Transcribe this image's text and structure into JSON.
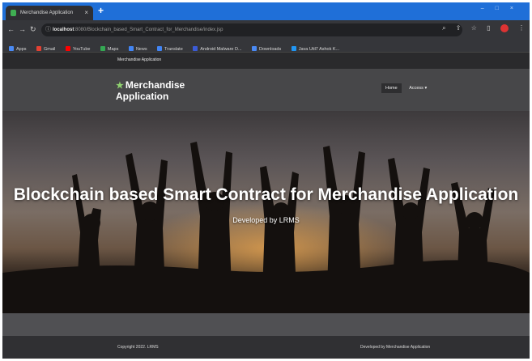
{
  "browser": {
    "tab_title": "Merchandise Application",
    "tab_close": "×",
    "new_tab": "+",
    "url_host": "localhost",
    "url_path": ":8080/Blockchain_based_Smart_Contract_for_Merchandise/index.jsp",
    "bookmarks": [
      {
        "label": "Apps",
        "color": "#4a8af4"
      },
      {
        "label": "Gmail",
        "color": "#e34133"
      },
      {
        "label": "YouTube",
        "color": "#ff0000"
      },
      {
        "label": "Maps",
        "color": "#34a853"
      },
      {
        "label": "News",
        "color": "#4285f4"
      },
      {
        "label": "Translate",
        "color": "#4285f4"
      },
      {
        "label": "Android Malware D...",
        "color": "#3b5bd6"
      },
      {
        "label": "Downloads",
        "color": "#4a8af4"
      },
      {
        "label": "Java Util7 Ashok K...",
        "color": "#2196f3"
      }
    ]
  },
  "page": {
    "top_strip": "Merchandise Application",
    "brand_line1": "Merchandise",
    "brand_line2": "Application",
    "nav": {
      "home": "Home",
      "access": "Access ▾"
    },
    "hero_title": "Blockchain based Smart Contract for Merchandise Application",
    "hero_subtitle": "Developed by LRMS",
    "footer_left": "Copyright 2022. LRMS",
    "footer_right": "Developed by Merchandise Application"
  },
  "colors": {
    "tabbar": "#1f6fd8",
    "brand_star": "#8fd16f"
  }
}
